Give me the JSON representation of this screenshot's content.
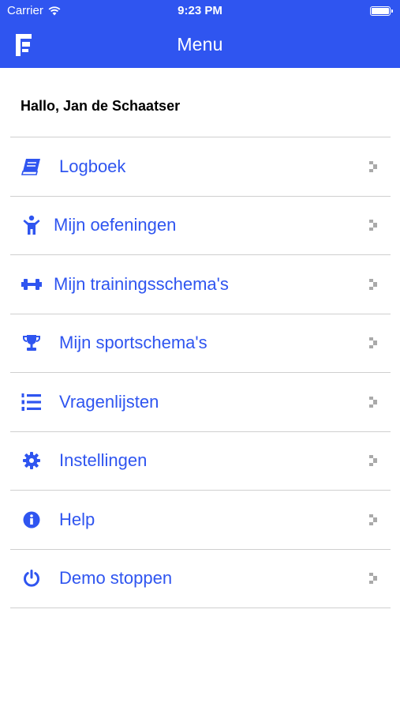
{
  "status_bar": {
    "carrier": "Carrier",
    "time": "9:23 PM"
  },
  "header": {
    "title": "Menu"
  },
  "greeting": "Hallo, Jan de Schaatser",
  "colors": {
    "accent": "#2f55f0",
    "divider": "#cfcfcf",
    "chevron": "#aaaaaa"
  },
  "menu": {
    "items": [
      {
        "label": "Logboek",
        "icon": "book-icon"
      },
      {
        "label": "Mijn oefeningen",
        "icon": "person-icon"
      },
      {
        "label": "Mijn trainingsschema's",
        "icon": "dumbbell-icon"
      },
      {
        "label": "Mijn sportschema's",
        "icon": "trophy-icon"
      },
      {
        "label": "Vragenlijsten",
        "icon": "numbered-list-icon"
      },
      {
        "label": "Instellingen",
        "icon": "gear-icon"
      },
      {
        "label": "Help",
        "icon": "info-icon"
      },
      {
        "label": "Demo stoppen",
        "icon": "power-icon"
      }
    ]
  }
}
